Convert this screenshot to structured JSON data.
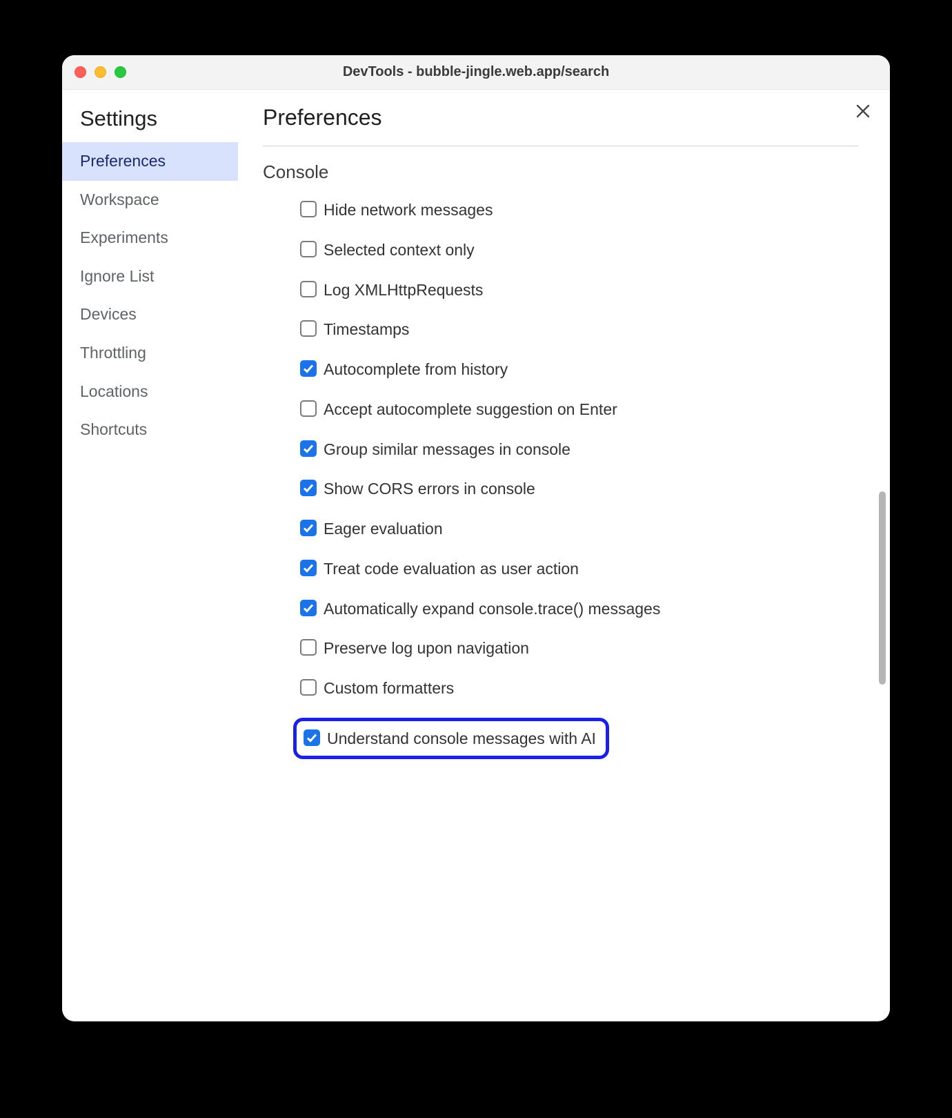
{
  "window": {
    "title": "DevTools - bubble-jingle.web.app/search"
  },
  "sidebar": {
    "title": "Settings",
    "items": [
      {
        "label": "Preferences",
        "selected": true
      },
      {
        "label": "Workspace",
        "selected": false
      },
      {
        "label": "Experiments",
        "selected": false
      },
      {
        "label": "Ignore List",
        "selected": false
      },
      {
        "label": "Devices",
        "selected": false
      },
      {
        "label": "Throttling",
        "selected": false
      },
      {
        "label": "Locations",
        "selected": false
      },
      {
        "label": "Shortcuts",
        "selected": false
      }
    ]
  },
  "page": {
    "title": "Preferences",
    "section": "Console",
    "options": [
      {
        "label": "Hide network messages",
        "checked": false,
        "highlighted": false
      },
      {
        "label": "Selected context only",
        "checked": false,
        "highlighted": false
      },
      {
        "label": "Log XMLHttpRequests",
        "checked": false,
        "highlighted": false
      },
      {
        "label": "Timestamps",
        "checked": false,
        "highlighted": false
      },
      {
        "label": "Autocomplete from history",
        "checked": true,
        "highlighted": false
      },
      {
        "label": "Accept autocomplete suggestion on Enter",
        "checked": false,
        "highlighted": false
      },
      {
        "label": "Group similar messages in console",
        "checked": true,
        "highlighted": false
      },
      {
        "label": "Show CORS errors in console",
        "checked": true,
        "highlighted": false
      },
      {
        "label": "Eager evaluation",
        "checked": true,
        "highlighted": false
      },
      {
        "label": "Treat code evaluation as user action",
        "checked": true,
        "highlighted": false
      },
      {
        "label": "Automatically expand console.trace() messages",
        "checked": true,
        "highlighted": false
      },
      {
        "label": "Preserve log upon navigation",
        "checked": false,
        "highlighted": false
      },
      {
        "label": "Custom formatters",
        "checked": false,
        "highlighted": false
      },
      {
        "label": "Understand console messages with AI",
        "checked": true,
        "highlighted": true
      }
    ]
  }
}
